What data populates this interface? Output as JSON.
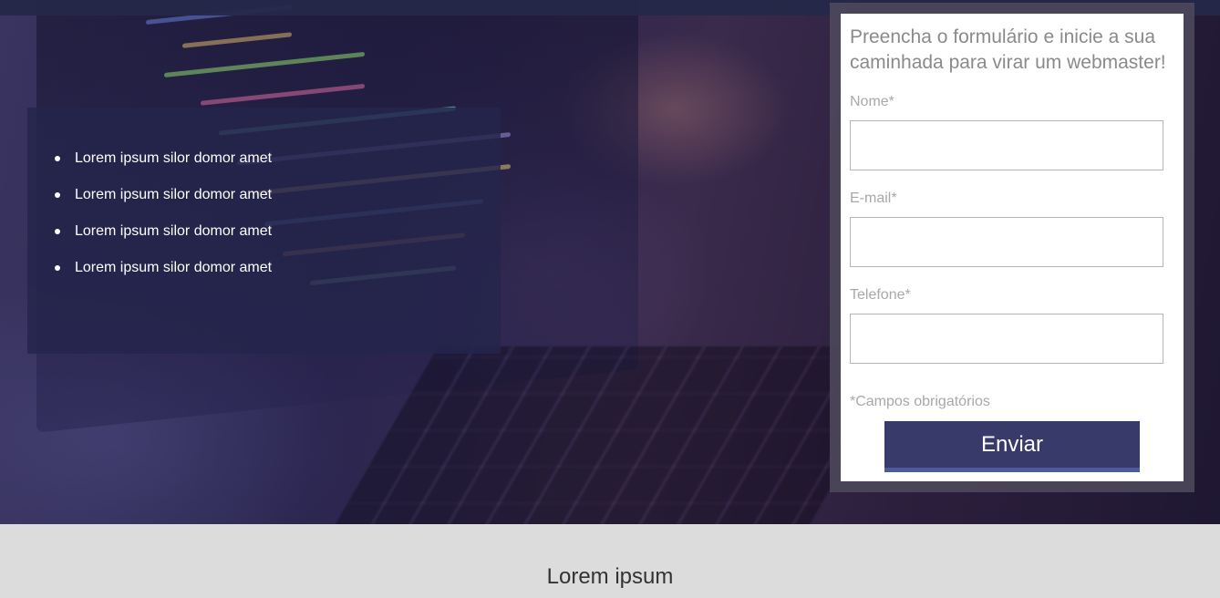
{
  "hero": {
    "features": [
      {
        "text": "Lorem ipsum silor domor amet"
      },
      {
        "text": "Lorem ipsum silor domor amet"
      },
      {
        "text": "Lorem ipsum silor domor amet"
      },
      {
        "text": "Lorem ipsum silor domor amet"
      }
    ]
  },
  "form": {
    "heading": "Preencha o formulário e inicie a sua caminhada para virar um webmaster!",
    "heading_line1": "Preencha o formulário e inicie a sua",
    "heading_line2": "caminhada para virar um webmaster!",
    "fields": [
      {
        "label": "Nome*",
        "value": ""
      },
      {
        "label": "E-mail*",
        "value": ""
      },
      {
        "label": "Telefone*",
        "value": ""
      }
    ],
    "required_note": "*Campos obrigatórios",
    "submit_label": "Enviar"
  },
  "next_section": {
    "title": "Lorem ipsum"
  },
  "colors": {
    "button_bg": "#383a6a",
    "button_border": "#4e5a9e",
    "panel_bg": "#24244c",
    "footer_bg": "#dcdcdc"
  }
}
